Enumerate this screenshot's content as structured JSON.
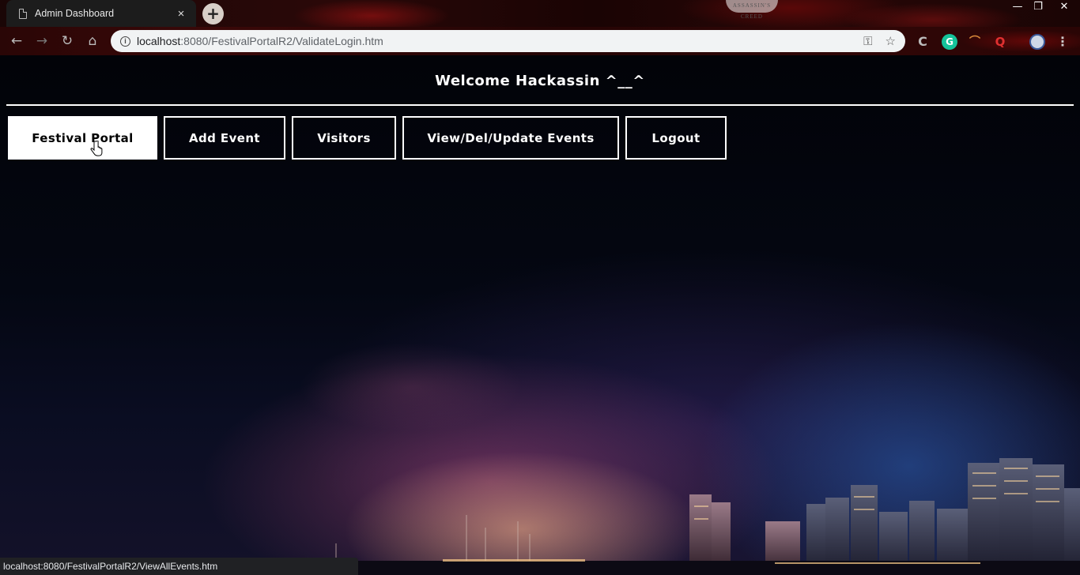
{
  "browser": {
    "tab_title": "Admin Dashboard",
    "tab_close": "×",
    "new_tab": "+",
    "brand_text": "ASSASSIN'S CREED",
    "url_host": "localhost",
    "url_rest": ":8080/FestivalPortalR2/ValidateLogin.htm",
    "window_controls": {
      "minimize": "—",
      "restore": "❐",
      "close": "✕"
    },
    "extensions": {
      "grammarly": "G",
      "quora": "Q"
    }
  },
  "page": {
    "welcome": "Welcome Hackassin ^__^",
    "nav": [
      {
        "label": "Festival Portal",
        "active": true
      },
      {
        "label": "Add Event",
        "active": false
      },
      {
        "label": "Visitors",
        "active": false
      },
      {
        "label": "View/Del/Update Events",
        "active": false
      },
      {
        "label": "Logout",
        "active": false
      }
    ]
  },
  "status_bar": {
    "url": "localhost:8080/FestivalPortalR2/ViewAllEvents.htm"
  },
  "colors": {
    "accent": "#ffffff",
    "background": "#03040b",
    "grammarly": "#15c39a",
    "quora": "#b92b27"
  }
}
